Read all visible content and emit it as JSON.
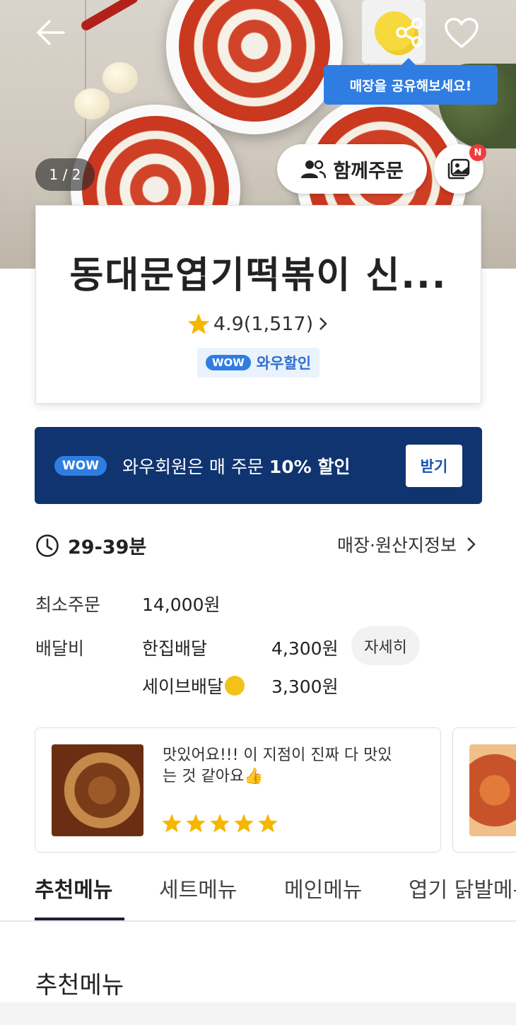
{
  "hero": {
    "photo_counter": "1 / 2",
    "share_tooltip": "매장을 공유해보세요!",
    "group_order_label": "함께주문",
    "photo_badge": "N",
    "icons": [
      "back-arrow-icon",
      "share-icon",
      "heart-icon",
      "group-icon",
      "photo-review-icon"
    ]
  },
  "store": {
    "name": "동대문엽기떡볶이 신...",
    "rating": "4.9(1,517)",
    "wow_tag": "WOW",
    "wow_label": "와우할인"
  },
  "wow_banner": {
    "tag": "WOW",
    "message_prefix": "와우회원은 매 주문 ",
    "message_bold": "10% 할인",
    "button_label": "받기"
  },
  "delivery_info": {
    "time": "29-39분",
    "origin_link": "매장·원산지정보",
    "min_order_label": "최소주문",
    "min_order_value": "14,000원",
    "fee_label": "배달비",
    "one_house_label": "한집배달",
    "one_house_price": "4,300원",
    "detail_button": "자세히",
    "save_label": "세이브배달",
    "save_price": "3,300원"
  },
  "review": {
    "text": "맛있어요!!! 이 지점이 진짜 다 맛있는 것 같아요👍",
    "stars": 5
  },
  "tabs": [
    "추천메뉴",
    "세트메뉴",
    "메인메뉴",
    "엽기 닭발메뉴"
  ],
  "section_title": "추천메뉴",
  "colors": {
    "wow_blue": "#2f7de1",
    "banner_navy": "#0f3470",
    "star": "#f5b800"
  }
}
